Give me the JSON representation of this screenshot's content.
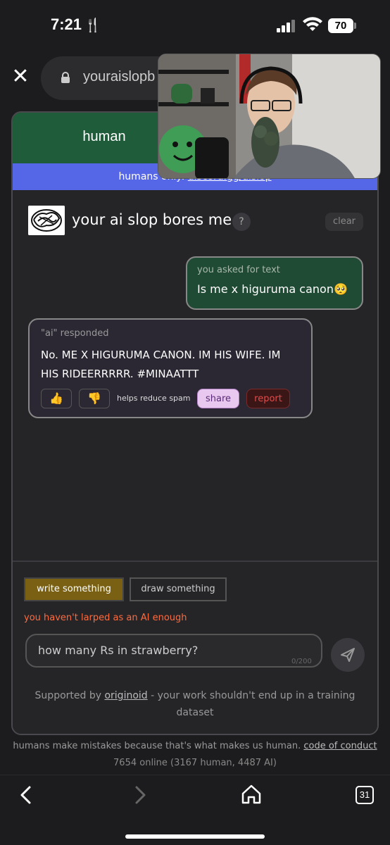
{
  "status_bar": {
    "time": "7:21",
    "battery": "70"
  },
  "browser": {
    "url": "youraislopb"
  },
  "tabs": {
    "human": "human"
  },
  "banner": {
    "prefix": "humans only: ",
    "link": "discord.gg/aislop"
  },
  "chat": {
    "title": "your ai slop bores me",
    "help": "?",
    "clear": "clear",
    "user_message": {
      "label": "you asked for text",
      "text": "Is me x higuruma canon🥺"
    },
    "ai_message": {
      "label": "\"ai\" responded",
      "text": "No. ME X HIGURUMA CANON. IM HIS WIFE. IM HIS RIDEERRRRR. #MINAATTT",
      "helps": "helps reduce spam",
      "share": "share",
      "report": "report"
    }
  },
  "compose": {
    "write_mode": "write something",
    "draw_mode": "draw something",
    "warning": "you haven't larped as an AI enough",
    "input_placeholder": "how many Rs in strawberry?",
    "counter": "0/200",
    "supported_prefix": "Supported by ",
    "supported_link": "originoid",
    "supported_suffix": " - your work shouldn't end up in a training dataset"
  },
  "footer": {
    "tagline": "humans make mistakes because that's what makes us human. ",
    "coc": "code of conduct",
    "online": "7654 online (3167 human, 4487 AI)"
  },
  "nav": {
    "tabs_count": "31"
  }
}
